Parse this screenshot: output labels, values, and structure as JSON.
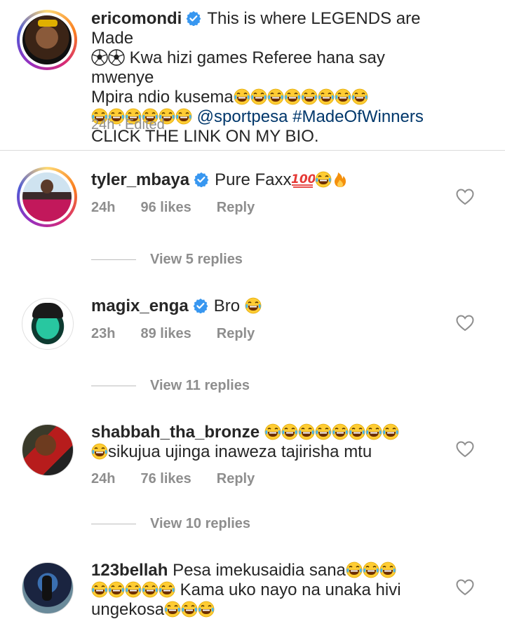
{
  "caption": {
    "username": "ericomondi",
    "text_line1": "This is where LEGENDS are Made",
    "text_line2": "Kwa hizi games Referee hana say mwenye",
    "text_line3": "Mpira ndio kusema",
    "mention": "@sportpesa",
    "hashtag": "#MadeOfWinners",
    "text_line5": "CLICK THE LINK ON MY BIO.",
    "time": "24h",
    "sep": "·",
    "edited": "Edited"
  },
  "comments": [
    {
      "username": "tyler_mbaya",
      "text": "Pure Faxx",
      "time": "24h",
      "likes": "96 likes",
      "reply": "Reply",
      "view_replies": "View 5 replies"
    },
    {
      "username": "magix_enga",
      "text": "Bro",
      "time": "23h",
      "likes": "89 likes",
      "reply": "Reply",
      "view_replies": "View 11 replies"
    },
    {
      "username": "shabbah_tha_bronze",
      "text_line2": "sikujua ujinga inaweza tajirisha mtu",
      "time": "24h",
      "likes": "76 likes",
      "reply": "Reply",
      "view_replies": "View 10 replies"
    },
    {
      "username": "123bellah",
      "text_line1": "Pesa imekusaidia sana",
      "text_line2": "Kama uko nayo na unaka hivi",
      "text_line3": "ungekosa"
    }
  ],
  "icons": {
    "verified": "verified-badge-icon",
    "heart": "heart-outline-icon",
    "laugh": "face-with-tears-of-joy-emoji",
    "ball": "soccer-ball-emoji",
    "hundred": "hundred-points-emoji",
    "fire": "fire-emoji"
  },
  "colors": {
    "verified": "#3897f0",
    "mention": "#00376b",
    "meta": "#8e8e8e",
    "emoji_yellow": "#ffcc33"
  }
}
